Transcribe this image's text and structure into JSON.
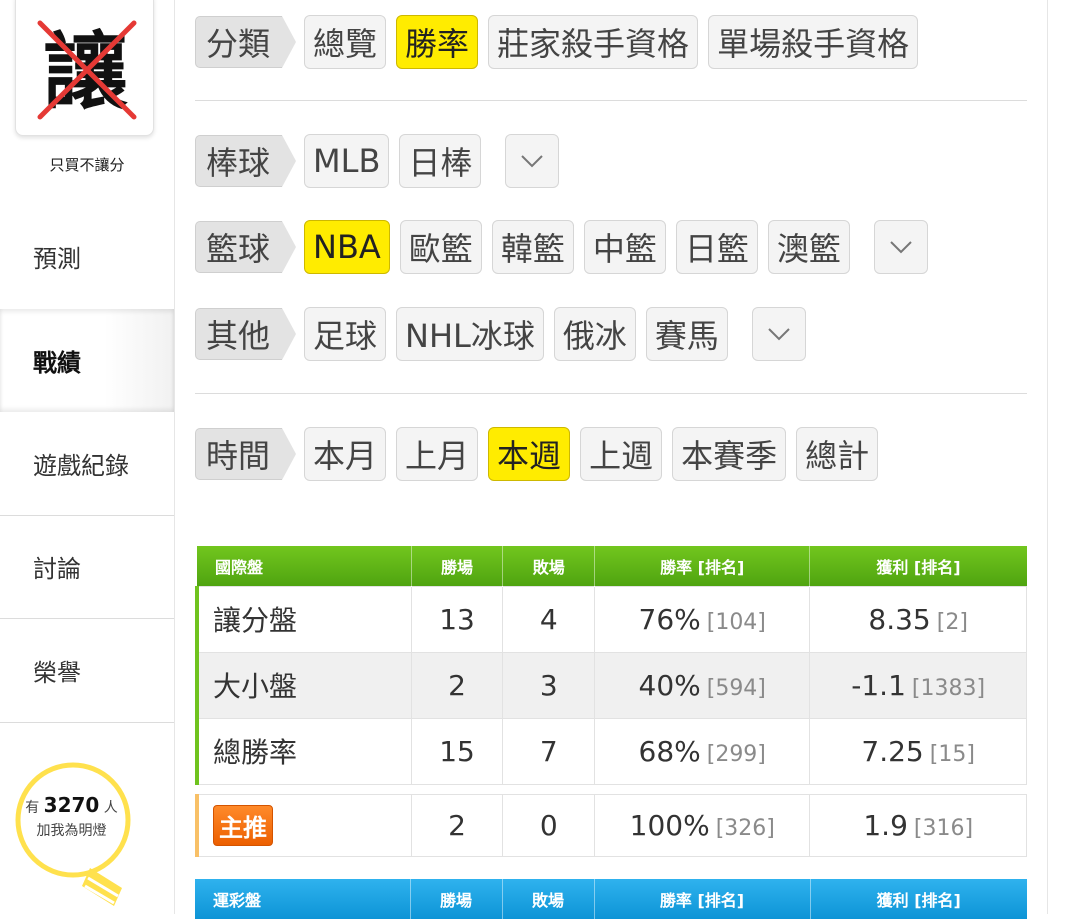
{
  "profile": {
    "nickname": "只買不讓分",
    "avatar_glyph": "讓",
    "avatar_mark": "x-cross-icon"
  },
  "nav": [
    {
      "label": "預測"
    },
    {
      "label": "戰績",
      "active": true
    },
    {
      "label": "遊戲紀錄"
    },
    {
      "label": "討論"
    },
    {
      "label": "榮譽"
    }
  ],
  "fans": {
    "prefix": "有",
    "count": "3270",
    "suffix": "人",
    "caption": "加我為明燈",
    "icon": "lightbulb-icon"
  },
  "filters": {
    "category": {
      "label": "分類",
      "options": [
        "總覽",
        "勝率",
        "莊家殺手資格",
        "單場殺手資格"
      ],
      "selected": "勝率"
    },
    "baseball": {
      "label": "棒球",
      "options": [
        "MLB",
        "日棒"
      ],
      "more_icon": "chevron-down-icon"
    },
    "basketball": {
      "label": "籃球",
      "options": [
        "NBA",
        "歐籃",
        "韓籃",
        "中籃",
        "日籃",
        "澳籃"
      ],
      "selected": "NBA",
      "more_icon": "chevron-down-icon"
    },
    "other": {
      "label": "其他",
      "options": [
        "足球",
        "NHL冰球",
        "俄冰",
        "賽馬"
      ],
      "more_icon": "chevron-down-icon"
    },
    "time": {
      "label": "時間",
      "options": [
        "本月",
        "上月",
        "本週",
        "上週",
        "本賽季",
        "總計"
      ],
      "selected": "本週"
    }
  },
  "international_table": {
    "headers": [
      "國際盤",
      "勝場",
      "敗場",
      "勝率 [排名]",
      "獲利 [排名]"
    ],
    "rows": [
      {
        "name": "讓分盤",
        "win": "13",
        "loss": "4",
        "rate": "76%",
        "rate_rank": "[104]",
        "profit": "8.35",
        "profit_rank": "[2]"
      },
      {
        "name": "大小盤",
        "win": "2",
        "loss": "3",
        "rate": "40%",
        "rate_rank": "[594]",
        "profit": "-1.1",
        "profit_rank": "[1383]"
      },
      {
        "name": "總勝率",
        "win": "15",
        "loss": "7",
        "rate": "68%",
        "rate_rank": "[299]",
        "profit": "7.25",
        "profit_rank": "[15]"
      }
    ]
  },
  "featured_row": {
    "badge": "主推",
    "win": "2",
    "loss": "0",
    "rate": "100%",
    "rate_rank": "[326]",
    "profit": "1.9",
    "profit_rank": "[316]"
  },
  "sports_lottery_table": {
    "headers": [
      "運彩盤",
      "勝場",
      "敗場",
      "勝率 [排名]",
      "獲利 [排名]"
    ]
  },
  "colors": {
    "selected": "#ffec00",
    "green_header": "#5cb414",
    "blue_header": "#13a0e0",
    "badge": "#f07010"
  }
}
